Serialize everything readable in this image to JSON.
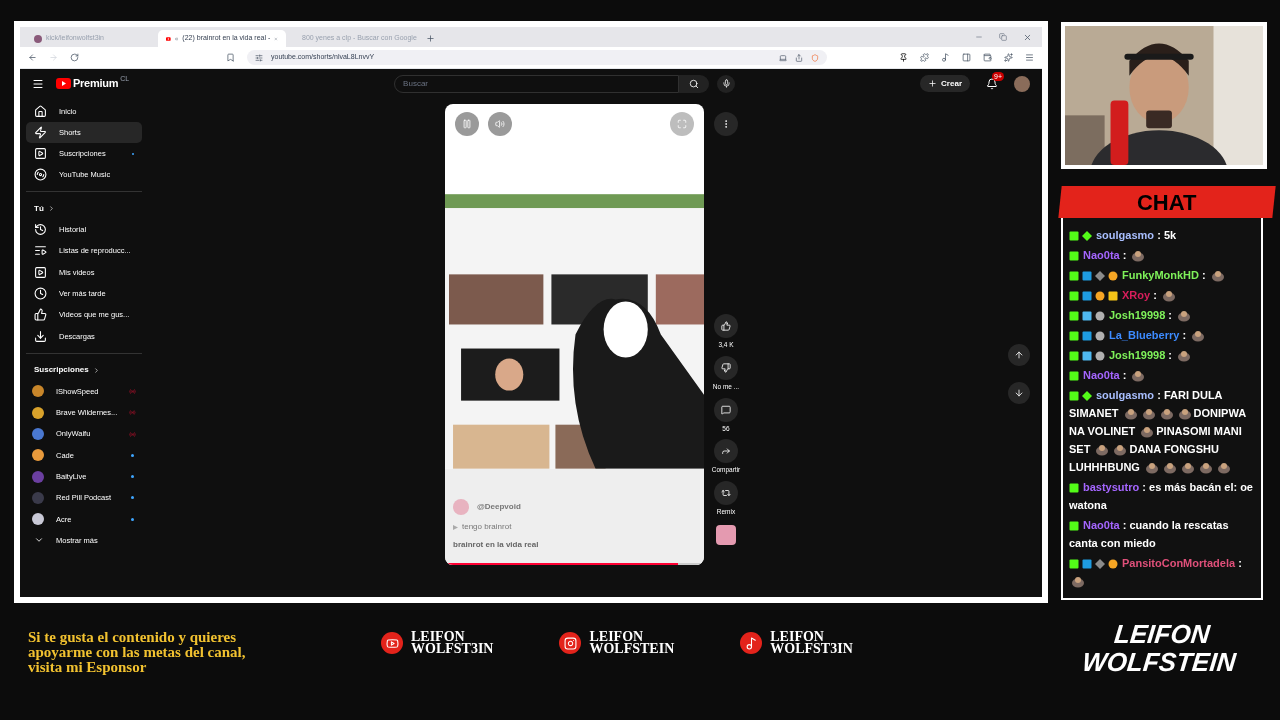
{
  "browser": {
    "tabs": [
      {
        "title": "kick/leifonwolfst3in",
        "selected": false,
        "kind": "kick"
      },
      {
        "title": "(22) brainrot en la vida real -",
        "selected": true,
        "kind": "youtube"
      },
      {
        "title": "800 yenes a clp - Buscar con Google",
        "selected": false,
        "kind": "google"
      }
    ],
    "url": "youtube.com/shorts/nlvaL8LnvvY"
  },
  "youtube": {
    "logo": "Premium",
    "region": "CL",
    "search_placeholder": "Buscar",
    "create": "Crear",
    "notifications": "9+",
    "nav": [
      {
        "label": "Inicio",
        "kind": "home",
        "selected": false,
        "new": false
      },
      {
        "label": "Shorts",
        "kind": "shorts",
        "selected": true,
        "new": false
      },
      {
        "label": "Suscripciones",
        "kind": "subscriptions",
        "selected": false,
        "new": true
      },
      {
        "label": "YouTube Music",
        "kind": "music",
        "selected": false,
        "new": false
      }
    ],
    "you_heading": "Tú",
    "you_items": [
      {
        "label": "Historial",
        "kind": "history"
      },
      {
        "label": "Listas de reproducc...",
        "kind": "playlists"
      },
      {
        "label": "Mis videos",
        "kind": "videos"
      },
      {
        "label": "Ver más tarde",
        "kind": "later"
      },
      {
        "label": "Videos que me gus...",
        "kind": "liked"
      },
      {
        "label": "Descargas",
        "kind": "downloads"
      }
    ],
    "subs_heading": "Suscripciones",
    "subscriptions": [
      {
        "name": "IShowSpeed",
        "kind": "live",
        "color": "#c8862a"
      },
      {
        "name": "Brave Wildernes...",
        "kind": "live",
        "color": "#d9a22b"
      },
      {
        "name": "OnlyWaifu",
        "kind": "live",
        "color": "#4a78d0"
      },
      {
        "name": "Cade",
        "kind": "new",
        "color": "#e89a3c"
      },
      {
        "name": "BaityLive",
        "kind": "new",
        "color": "#6b3fa0"
      },
      {
        "name": "Red Pill Podcast",
        "kind": "new",
        "color": "#3a3a4a"
      },
      {
        "name": "Acre",
        "kind": "new",
        "color": "#c9c9d6"
      }
    ],
    "show_more": "Mostrar más",
    "short": {
      "channel": "@Deepvoid",
      "song": "tengo brainrot",
      "caption": "brainrot en la vida real",
      "level": 0.9,
      "actions": [
        {
          "kind": "like",
          "label": "3,4 K"
        },
        {
          "kind": "dislike",
          "label": "No me ..."
        },
        {
          "kind": "comments",
          "label": "56"
        },
        {
          "kind": "share",
          "label": "Compartir"
        },
        {
          "kind": "remix",
          "label": "Remix"
        }
      ]
    }
  },
  "chat": {
    "title": "CHAT",
    "messages": [
      {
        "user": "soulgasmo",
        "sep": ":",
        "color": "#a9bfff",
        "badges": [
          {
            "kind": "kick"
          },
          {
            "kind": "sparkle"
          }
        ],
        "parts": [
          {
            "kind": "text",
            "text": "5k"
          }
        ]
      },
      {
        "user": "Nao0ta",
        "sep": ":",
        "color": "#a566ff",
        "badges": [
          {
            "kind": "kick"
          }
        ],
        "parts": [
          {
            "kind": "emote"
          }
        ]
      },
      {
        "user": "FunkyMonkHD",
        "sep": ":",
        "color": "#7ff25a",
        "badges": [
          {
            "kind": "kick"
          },
          {
            "kind": "hammer"
          },
          {
            "kind": "sword"
          },
          {
            "kind": "coin"
          }
        ],
        "parts": [
          {
            "kind": "emote"
          }
        ]
      },
      {
        "user": "XRoy",
        "sep": ":",
        "color": "#d81e5b",
        "badges": [
          {
            "kind": "kick"
          },
          {
            "kind": "hammer"
          },
          {
            "kind": "coin"
          },
          {
            "kind": "crown"
          }
        ],
        "parts": [
          {
            "kind": "emote"
          }
        ]
      },
      {
        "user": "Josh19998",
        "sep": ":",
        "color": "#7ff25a",
        "badges": [
          {
            "kind": "kick"
          },
          {
            "kind": "cube"
          },
          {
            "kind": "skull"
          }
        ],
        "parts": [
          {
            "kind": "emote"
          }
        ]
      },
      {
        "user": "La_Blueberry",
        "sep": ":",
        "color": "#3d8bff",
        "badges": [
          {
            "kind": "kick"
          },
          {
            "kind": "hammer"
          },
          {
            "kind": "skull"
          }
        ],
        "parts": [
          {
            "kind": "emote"
          }
        ]
      },
      {
        "user": "Josh19998",
        "sep": ":",
        "color": "#7ff25a",
        "badges": [
          {
            "kind": "kick"
          },
          {
            "kind": "cube"
          },
          {
            "kind": "skull"
          }
        ],
        "parts": [
          {
            "kind": "emote"
          }
        ]
      },
      {
        "user": "Nao0ta",
        "sep": ":",
        "color": "#a566ff",
        "badges": [
          {
            "kind": "kick"
          }
        ],
        "parts": [
          {
            "kind": "emote"
          }
        ]
      },
      {
        "user": "soulgasmo",
        "sep": ":",
        "color": "#a9bfff",
        "badges": [
          {
            "kind": "kick"
          },
          {
            "kind": "sparkle"
          }
        ],
        "parts": [
          {
            "kind": "text",
            "text": "FARI DULA SIMANET"
          },
          {
            "kind": "emote"
          },
          {
            "kind": "emote"
          },
          {
            "kind": "emote"
          },
          {
            "kind": "emote"
          },
          {
            "kind": "text",
            "text": "DONIPWA NA VOLINET"
          },
          {
            "kind": "emote"
          },
          {
            "kind": "text",
            "text": "PINASOMI MANI SET"
          },
          {
            "kind": "emote"
          },
          {
            "kind": "emote"
          },
          {
            "kind": "text",
            "text": "DANA FONGSHU LUHHHBUNG"
          },
          {
            "kind": "emote"
          },
          {
            "kind": "emote"
          },
          {
            "kind": "emote"
          },
          {
            "kind": "emote"
          },
          {
            "kind": "emote"
          }
        ]
      },
      {
        "user": "bastysutro",
        "sep": ":",
        "color": "#a566ff",
        "badges": [
          {
            "kind": "kick"
          }
        ],
        "parts": [
          {
            "kind": "text",
            "text": "es más bacán el: oe watona"
          }
        ]
      },
      {
        "user": "Nao0ta",
        "sep": ":",
        "color": "#a566ff",
        "badges": [
          {
            "kind": "kick"
          }
        ],
        "parts": [
          {
            "kind": "text",
            "text": "cuando la rescatas canta con miedo"
          }
        ]
      },
      {
        "user": "PansitoConMortadela",
        "sep": ":",
        "color": "#e0507a",
        "badges": [
          {
            "kind": "kick"
          },
          {
            "kind": "hammer"
          },
          {
            "kind": "sword"
          },
          {
            "kind": "coin"
          }
        ],
        "parts": [
          {
            "kind": "emote"
          }
        ]
      }
    ]
  },
  "banner": {
    "sponsor": "Si te gusta el contenido y quieres apoyarme con las metas del canal, visita mi Esponsor",
    "socials": [
      {
        "kind": "youtube",
        "lines": [
          "LEIFON",
          "WOLFST3IN"
        ]
      },
      {
        "kind": "instagram",
        "lines": [
          "LEIFON",
          "WOLFSTEIN"
        ]
      },
      {
        "kind": "tiktok",
        "lines": [
          "LEIFON",
          "WOLFST3IN"
        ]
      }
    ],
    "logo": [
      "LEIFON",
      "WOLFSTEIN"
    ]
  }
}
